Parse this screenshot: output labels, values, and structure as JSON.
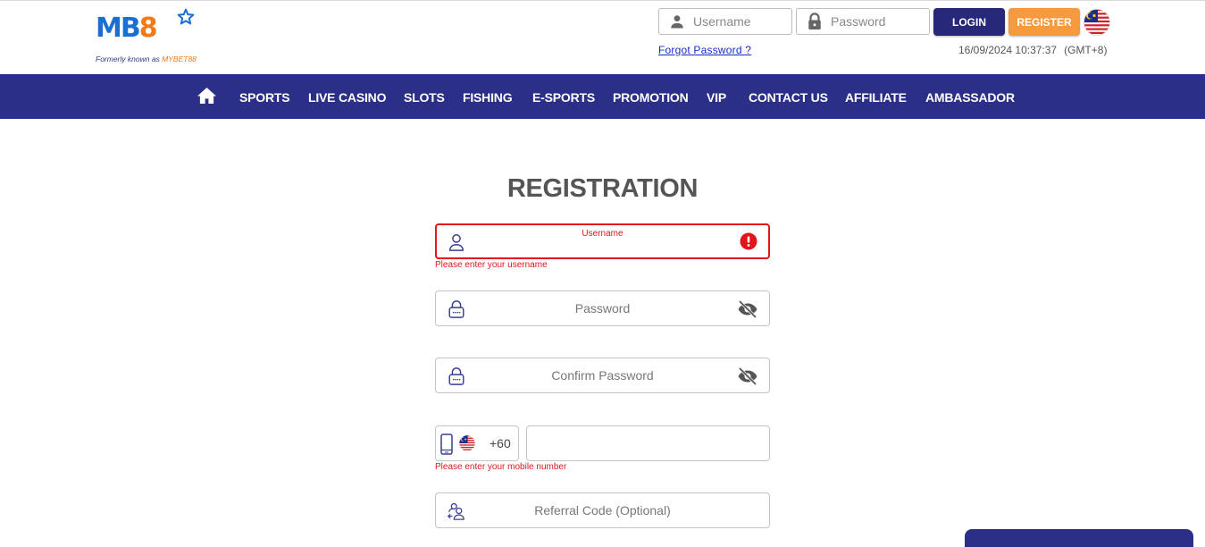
{
  "header": {
    "logo": {
      "brand_left": "MB",
      "brand_right": "8",
      "tagline_prefix": "Formerly known as ",
      "tagline_brand": "MYBET88"
    },
    "login": {
      "username_placeholder": "Username",
      "password_placeholder": "Password",
      "login_label": "LOGIN",
      "register_label": "REGISTER",
      "forgot_label": "Forgot Password ?",
      "language_flag": "malaysia-flag-icon"
    },
    "datetime": "16/09/2024 10:37:37",
    "timezone": "(GMT+8)"
  },
  "nav": {
    "home_icon": "home-icon",
    "items": [
      {
        "label": "SPORTS"
      },
      {
        "label": "LIVE CASINO"
      },
      {
        "label": "SLOTS"
      },
      {
        "label": "FISHING"
      },
      {
        "label": "E-SPORTS"
      },
      {
        "label": "PROMOTION"
      },
      {
        "label": "VIP"
      },
      {
        "label": "CONTACT US"
      },
      {
        "label": "AFFILIATE"
      },
      {
        "label": "AMBASSADOR"
      }
    ]
  },
  "form": {
    "title": "REGISTRATION",
    "username": {
      "label": "Username",
      "value": "",
      "error": "Please enter your username",
      "icon": "user-icon",
      "status_icon": "error-alert-icon"
    },
    "password": {
      "placeholder": "Password",
      "value": "",
      "icon": "lock-icon",
      "toggle_icon": "eye-slash-icon"
    },
    "confirm_password": {
      "placeholder": "Confirm Password",
      "value": "",
      "icon": "lock-icon",
      "toggle_icon": "eye-slash-icon"
    },
    "mobile": {
      "prefix": "+60",
      "country_flag": "malaysia-flag-icon",
      "value": "",
      "error": "Please enter your mobile number",
      "icon": "mobile-phone-icon"
    },
    "referral": {
      "placeholder": "Referral Code (Optional)",
      "value": "",
      "icon": "referral-users-icon"
    }
  },
  "colors": {
    "nav_bg": "#2b2f88",
    "login_btn": "#27287a",
    "register_btn": "#f79a3e",
    "error": "#e3151a",
    "title": "#555555",
    "icon_accent": "#3a3f94"
  }
}
